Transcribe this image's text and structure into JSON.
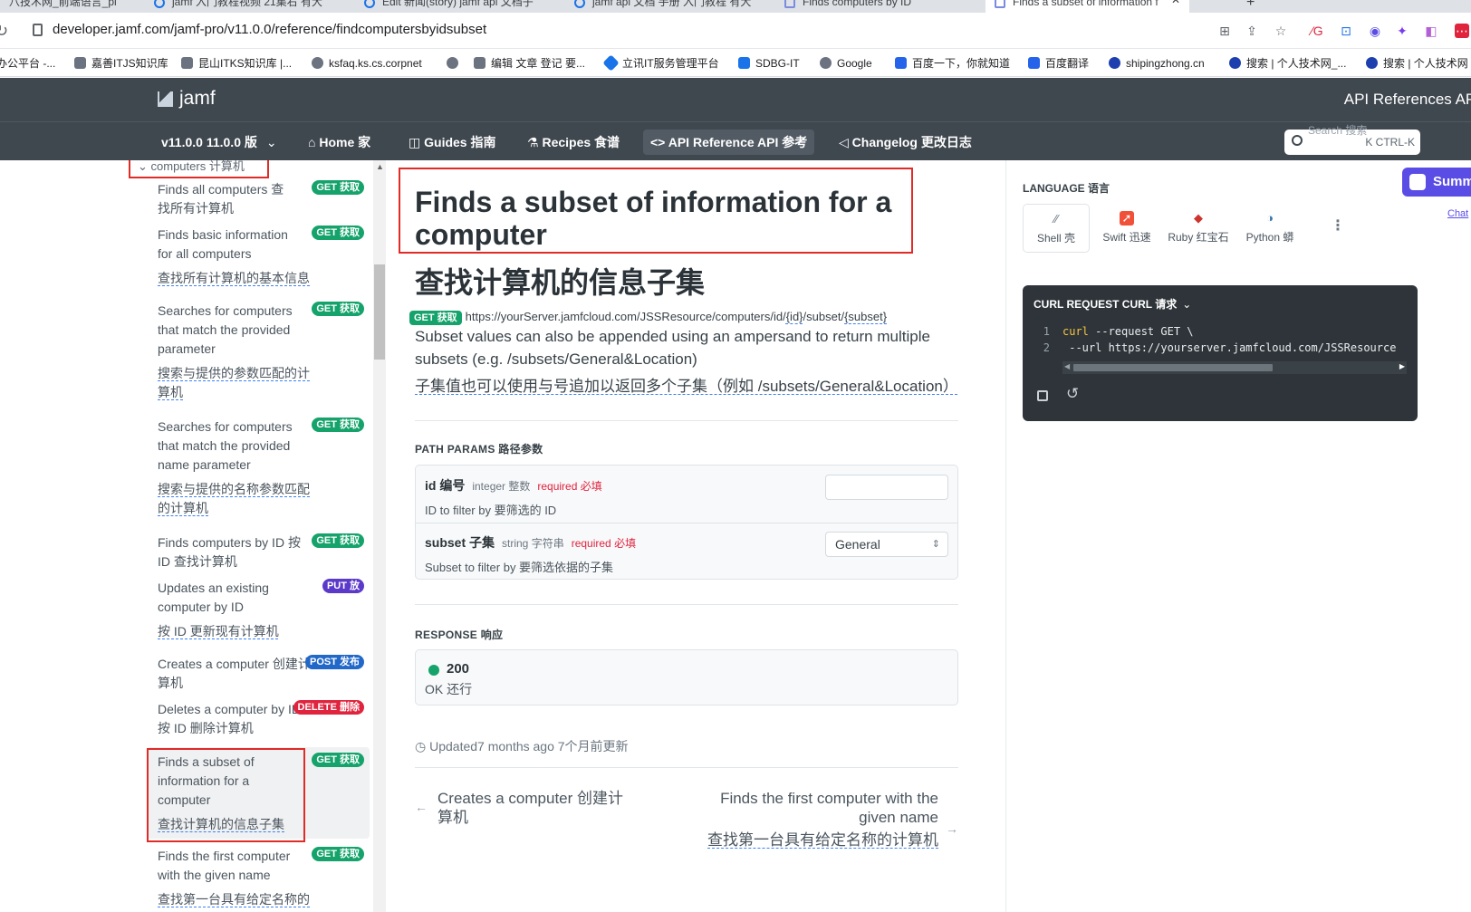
{
  "browser": {
    "tabs": [
      {
        "label": "八技术网_前端语言_pl"
      },
      {
        "label": "jamf 入门教程视频 21集右 有大"
      },
      {
        "label": "Edit 新闻(story) jamf api 文档子"
      },
      {
        "label": "jamf api 文档 手册 入门教程 有大"
      },
      {
        "label": "Finds computers by ID"
      },
      {
        "label": "Finds a subset of information f"
      }
    ],
    "new_tab": "+",
    "url": "developer.jamf.com/jamf-pro/v11.0.0/reference/findcomputersbyidsubset",
    "bookmarks": [
      "办公平台 -...",
      "嘉善ITJS知识库",
      "昆山ITKS知识库 |...",
      "ksfaq.ks.cs.corpnet",
      "",
      "编辑 文章 登记 要...",
      "立讯IT服务管理平台",
      "SDBG-IT",
      "Google",
      "百度一下，你就知道",
      "百度翻译",
      "shipingzhong.cn",
      "搜索 | 个人技术网_...",
      "搜索 | 个人技术网"
    ]
  },
  "header": {
    "logo_text": "jamf",
    "links": "API References  API"
  },
  "nav": {
    "version": "v11.0.0 11.0.0 版",
    "items": [
      "Home 家",
      "Guides 指南",
      "Recipes 食谱",
      "API Reference API 参考",
      "Changelog 更改日志"
    ],
    "search_text": "Search 搜索",
    "search_shortcut": "K CTRL-K"
  },
  "sidebar": {
    "category": "computers 计算机",
    "items": [
      {
        "en": "Finds all computers 查找所有计算机",
        "zh": "",
        "method": "GET 获取"
      },
      {
        "en": "Finds basic information for all computers",
        "zh": "查找所有计算机的基本信息",
        "method": "GET 获取"
      },
      {
        "en": "Searches for computers that match the provided parameter",
        "zh": "搜索与提供的参数匹配的计算机",
        "method": "GET 获取"
      },
      {
        "en": "Searches for computers that match the provided name parameter",
        "zh": "搜索与提供的名称参数匹配的计算机",
        "method": "GET 获取"
      },
      {
        "en": "Finds computers by ID 按 ID 查找计算机",
        "zh": "",
        "method": "GET 获取"
      },
      {
        "en": "Updates an existing computer by ID",
        "zh": "按 ID 更新现有计算机",
        "method": "PUT 放"
      },
      {
        "en": "Creates a computer 创建计算机",
        "zh": "",
        "method": "POST 发布"
      },
      {
        "en": "Deletes a computer by ID 按 ID 删除计算机",
        "zh": "",
        "method": "DELETE 删除"
      },
      {
        "en": "Finds a subset of information for a computer",
        "zh": "查找计算机的信息子集",
        "method": "GET 获取"
      },
      {
        "en": "Finds the first computer with the given name",
        "zh": "查找第一台具有给定名称的",
        "method": "GET 获取"
      }
    ]
  },
  "content": {
    "title": "Finds a subset of information for a computer",
    "title_zh": "查找计算机的信息子集",
    "method": "GET 获取",
    "endpoint_prefix": "https://yourServer.jamfcloud.com/JSSResource/computers/id/",
    "endpoint_id": "{id}",
    "endpoint_mid": "/subset/",
    "endpoint_subset": "{subset}",
    "desc": "Subset values can also be appended using an ampersand to return multiple subsets (e.g. /subsets/General&Location)",
    "desc_zh": "子集值也可以使用与号追加以返回多个子集（例如 /subsets/General&Location）",
    "path_params_label": "PATH PARAMS 路径参数",
    "params": [
      {
        "name": "id 编号",
        "type": "integer 整数",
        "required": "required 必填",
        "desc": "ID to filter by 要筛选的 ID",
        "value": ""
      },
      {
        "name": "subset 子集",
        "type": "string 字符串",
        "required": "required 必填",
        "desc": "Subset to filter by 要筛选依据的子集",
        "value": "General"
      }
    ],
    "response_label": "RESPONSE 响应",
    "response_code": "200",
    "response_text": "OK 还行",
    "updated": "Updated7 months ago 7个月前更新",
    "prev_en": "Creates a computer 创建计算机",
    "next_en": "Finds the first computer with the given name",
    "next_zh": "查找第一台具有给定名称的计算机"
  },
  "right": {
    "lang_label": "LANGUAGE 语言",
    "langs": [
      "Shell 壳",
      "Swift 迅速",
      "Ruby 红宝石",
      "Python 蟒"
    ],
    "curl_header": "CURL REQUEST CURL 请求",
    "code": [
      {
        "n": "1",
        "cmd": "curl",
        "rest": " --request GET \\"
      },
      {
        "n": "2",
        "cmd": "",
        "rest": "     --url https://yourserver.jamfcloud.com/JSSResource"
      }
    ],
    "summ": "Summ",
    "chat": "Chat"
  },
  "colors": {
    "accent_red": "#e02b27",
    "get": "#15a36b",
    "put": "#5b3ac9",
    "post": "#2168c9",
    "delete": "#e0243e",
    "header_bg": "#3f474f"
  }
}
